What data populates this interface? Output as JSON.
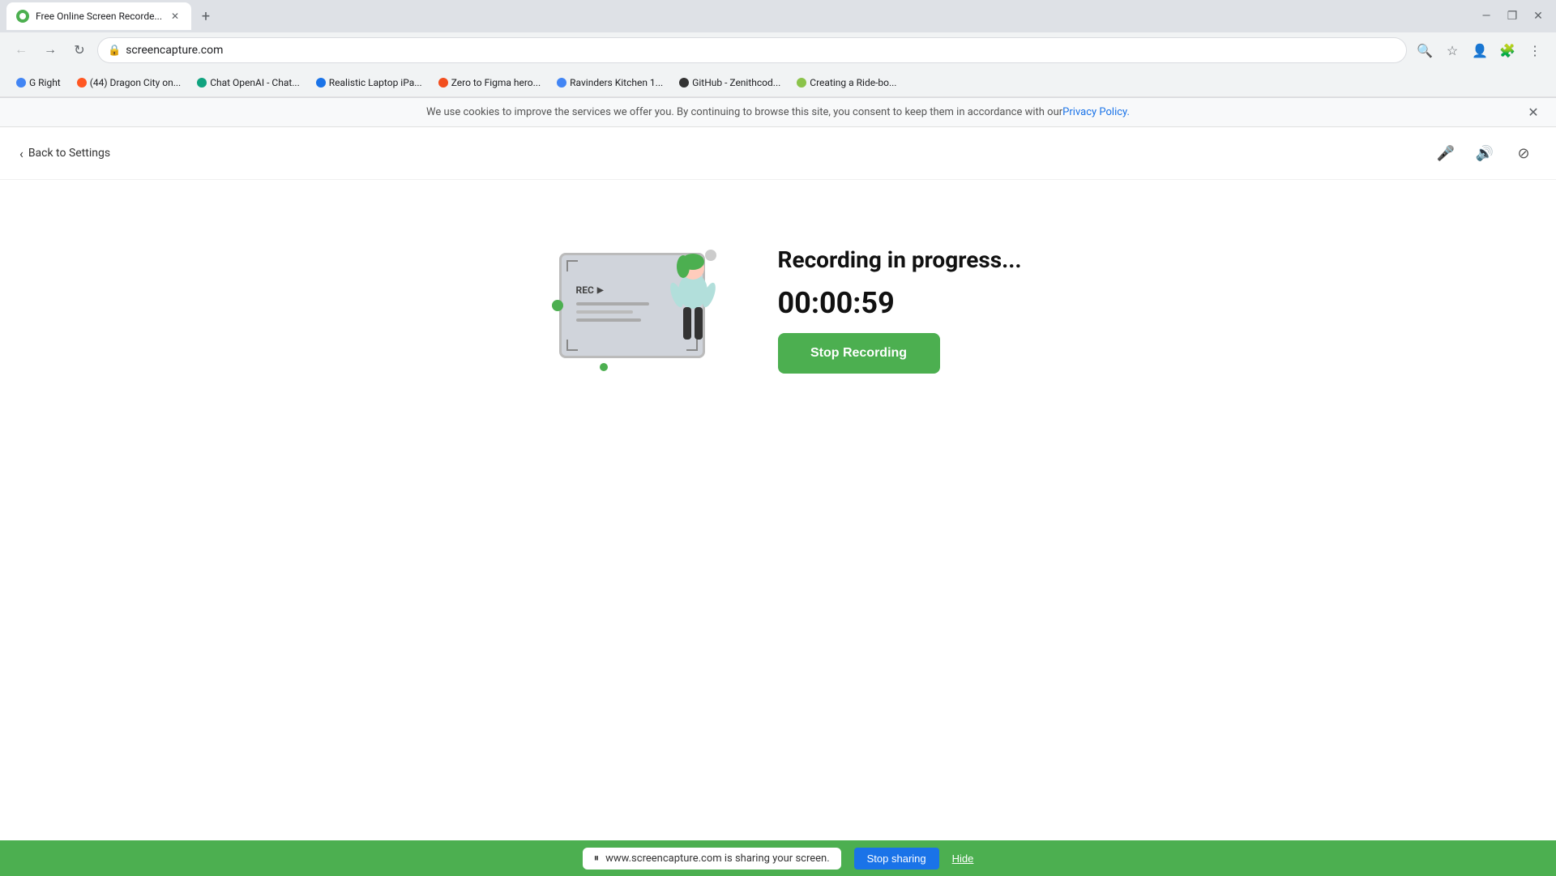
{
  "browser": {
    "tab": {
      "favicon_color": "#4caf50",
      "title": "Free Online Screen Recorde...",
      "active": true
    },
    "address": "screencapture.com",
    "bookmarks": [
      {
        "label": "G Right",
        "color": "#4285f4"
      },
      {
        "label": "(44) Dragon City on...",
        "color": "#ff5722"
      },
      {
        "label": "Chat OpenAI - Chat...",
        "color": "#10a37f"
      },
      {
        "label": "Realistic Laptop iPa...",
        "color": "#1a73e8"
      },
      {
        "label": "Zero to Figma hero...",
        "color": "#f24e1e"
      },
      {
        "label": "Ravinders Kitchen 1...",
        "color": "#4285f4"
      },
      {
        "label": "GitHub - Zenithcod...",
        "color": "#333"
      },
      {
        "label": "Creating a Ride-bo...",
        "color": "#8bc34a"
      }
    ]
  },
  "cookie_banner": {
    "text": "We use cookies to improve the services we offer you. By continuing to browse this site, you consent to keep them in accordance with our ",
    "link_text": "Privacy Policy."
  },
  "toolbar": {
    "back_label": "Back to Settings"
  },
  "main": {
    "status_label": "Recording in progress...",
    "timer": "00:00:59",
    "stop_button_label": "Stop Recording"
  },
  "illus": {
    "rec_label": "REC"
  },
  "screen_share": {
    "info_text": "www.screencapture.com is sharing your screen.",
    "stop_label": "Stop sharing",
    "hide_label": "Hide"
  }
}
